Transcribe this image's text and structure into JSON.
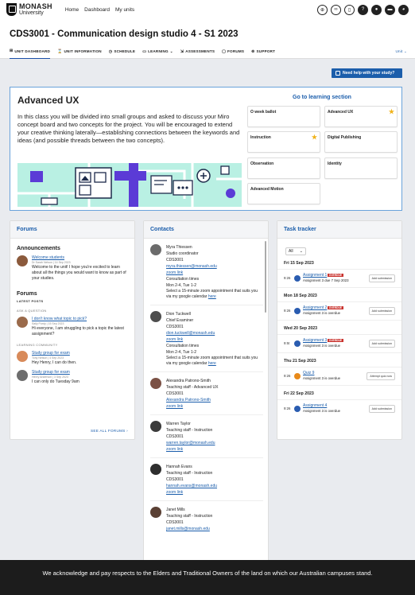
{
  "topbar": {
    "logo_main": "MONASH",
    "logo_sub": "University",
    "nav": [
      "Home",
      "Dashboard",
      "My units"
    ],
    "icons": [
      "search-zoom-icon",
      "link-icon",
      "book-icon",
      "help-icon",
      "notifications-icon",
      "messages-icon",
      "user-icon"
    ]
  },
  "course": {
    "title": "CDS3001 - Communication design studio 4 - S1 2023"
  },
  "tabs": [
    {
      "label": "UNIT DASHBOARD",
      "icon": "⊞"
    },
    {
      "label": "UNIT INFORMATION",
      "icon": "⌛"
    },
    {
      "label": "SCHEDULE",
      "icon": "◷"
    },
    {
      "label": "LEARNING",
      "icon": "▭",
      "dropdown": true
    },
    {
      "label": "ASSESSMENTS",
      "icon": "⇲"
    },
    {
      "label": "FORUMS",
      "icon": "▢"
    },
    {
      "label": "SUPPORT",
      "icon": "⊚"
    }
  ],
  "tabs_unit": "Unit ⌄",
  "help_button": "Need help with your study?",
  "advanced": {
    "title": "Advanced UX",
    "description": "In this class you will be divided into small groups and asked to discuss your Miro concept board and two concepts for the project. You will be encouraged to extend your creative thinking laterally—establishing connections between the keywords and ideas (and possible threads between the two concepts).",
    "go_link": "Go to learning section",
    "sections": [
      {
        "label": "O week ballot",
        "star": false
      },
      {
        "label": "Advanced UX",
        "star": true
      },
      {
        "label": "Instruction",
        "star": true
      },
      {
        "label": "Digital Publishing",
        "star": false
      },
      {
        "label": "Observation",
        "star": false
      },
      {
        "label": "Identity",
        "star": false
      },
      {
        "label": "Advanced Motion",
        "star": false
      }
    ]
  },
  "forums": {
    "title": "Forums",
    "announcements_title": "Announcements",
    "announcement": {
      "link": "Welcome students",
      "meta": "Dr Sarah Nelson | 14 Sep 2023",
      "text": "Welcome to the unit! I hope you're excited to learn about all the things you would want to know as part of your studies."
    },
    "forums_title": "Forums",
    "latest": "LATEST POSTS",
    "cat1": "ASK A QUESTION",
    "post1": {
      "link": "I don't know what topic to pick?",
      "meta": "Sally Purdy | 15 Sep 2023",
      "text": "Hi everyone, I am struggling to pick a topic the latest assignment?"
    },
    "cat2": "LEARNING COMMUNITY",
    "post2": {
      "link": "Study group for exam",
      "meta": "Tony Nelson | 4 Sep 2023",
      "text": "Hey Henry, I can do then."
    },
    "post3": {
      "link": "Study group for exam",
      "meta": "Henry Anderson | 3 Sep 2023",
      "text": "I can only do Tuesday 9am"
    },
    "see_all": "SEE ALL FORUMS ›"
  },
  "contacts": {
    "title": "Contacts",
    "list": [
      {
        "name": "Myra Thiessen",
        "role": "Studio coordinator",
        "unit": "CDS3001",
        "email": "myra.thiessen@monash.edu",
        "zoom": "zoom link",
        "times_label": "Consultation times",
        "times": "Mon 2-4, Tue 1-2",
        "note": "Select a 15-minute zoom appointment that suits you via my google calendar ",
        "note_link": "here"
      },
      {
        "name": "Dion Tuckwell",
        "role": "Chief Examiner",
        "unit": "CDS3001",
        "email": "dion.tuckwell@monash.edu",
        "zoom": "zoom link",
        "times_label": "Consultation times",
        "times": "Mon 2-4, Tue 1-2",
        "note": "Select a 15-minute zoom appointment that suits you via my google calendar ",
        "note_link": "here"
      },
      {
        "name": "Alexandra Patrono-Smith",
        "role": "Teaching staff - Advanced UX",
        "unit": "CDS3001",
        "email": "Alexandra Patrono-Smith",
        "zoom": "zoom link"
      },
      {
        "name": "Warren Taylor",
        "role": "Teaching staff - Instruction",
        "unit": "CDS3001",
        "email": "warren.taylor@monash.edu",
        "zoom": "zoom link"
      },
      {
        "name": "Hannah Evans",
        "role": "Teaching staff - Instruction",
        "unit": "CDS3001",
        "email": "hannah.evans@monash.edu",
        "zoom": "zoom link"
      },
      {
        "name": "Janet Mills",
        "role": "Teaching staff - Instruction",
        "unit": "CDS3001",
        "email": "janet.mills@monash.edu"
      }
    ]
  },
  "tasks": {
    "title": "Task tracker",
    "filter": "All",
    "days": [
      {
        "date": "Fri 15 Sep 2023",
        "items": [
          {
            "time": "9:26",
            "link": "Assignment 1",
            "overdue": "OVERDUE",
            "detail": "Assignment 3 due 7 Sep 2023",
            "button": "Add submission",
            "icon": "blue"
          }
        ]
      },
      {
        "date": "Mon 18 Sep 2023",
        "items": [
          {
            "time": "9:26",
            "link": "Assignment 2",
            "overdue": "OVERDUE",
            "detail": "Assignment 3 is overdue",
            "button": "Add submission",
            "icon": "blue"
          }
        ]
      },
      {
        "date": "Wed 20 Sep 2023",
        "items": [
          {
            "time": "9:5t",
            "link": "Assignment 3",
            "overdue": "OVERDUE",
            "detail": "Assignment 3 is overdue",
            "button": "Add submission",
            "icon": "blue"
          }
        ]
      },
      {
        "date": "Thu 21 Sep 2023",
        "items": [
          {
            "time": "9:26",
            "link": "Quiz 9",
            "overdue": "",
            "detail": "Assignment 3 is overdue",
            "button": "Attempt quiz now",
            "icon": "orange"
          }
        ]
      },
      {
        "date": "Fri 22 Sep 2023",
        "items": [
          {
            "time": "9:26",
            "link": "Assignment 4",
            "overdue": "",
            "detail": "Assignment 3 is overdue",
            "button": "Add submission",
            "icon": "blue"
          }
        ]
      }
    ]
  },
  "footer": "We acknowledge and pay respects to the Elders and Traditional Owners of the land on which our Australian campuses stand."
}
